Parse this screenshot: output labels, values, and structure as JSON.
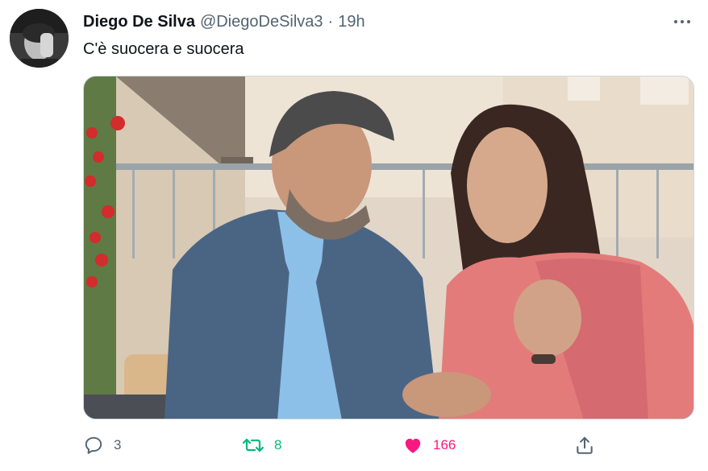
{
  "tweet": {
    "author_name": "Diego De Silva",
    "author_handle": "@DiegoDeSilva3",
    "separator": "·",
    "time": "19h",
    "text": "C'è suocera e suocera"
  },
  "actions": {
    "reply_count": "3",
    "retweet_count": "8",
    "like_count": "166"
  },
  "colors": {
    "retweet_active": "#00ba7c",
    "like_active": "#f91880",
    "secondary_text": "#536471"
  },
  "icons": {
    "more": "more-dots-icon",
    "reply": "reply-bubble-icon",
    "retweet": "retweet-arrows-icon",
    "like": "heart-filled-icon",
    "share": "share-upload-icon"
  }
}
